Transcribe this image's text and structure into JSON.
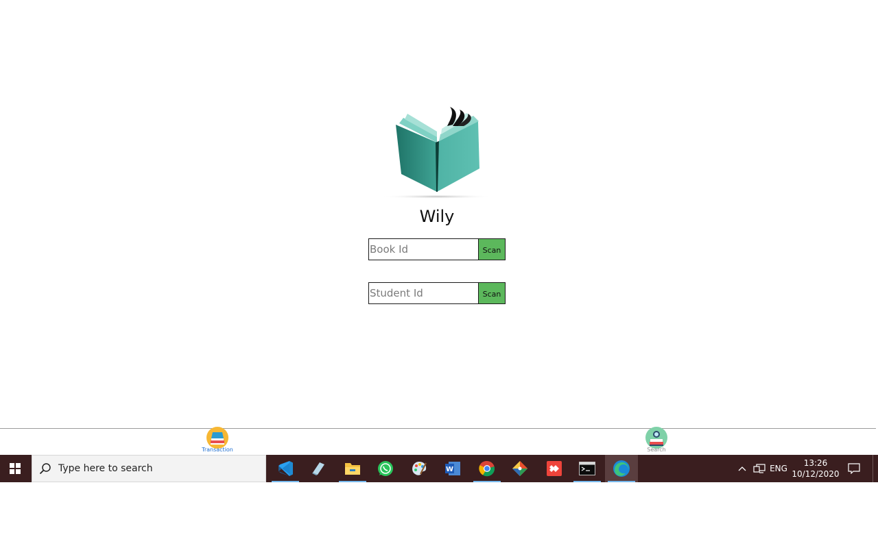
{
  "app": {
    "title": "Wily",
    "book_input": {
      "placeholder": "Book Id",
      "value": ""
    },
    "book_scan_label": "Scan",
    "student_input": {
      "placeholder": "Student Id",
      "value": ""
    },
    "student_scan_label": "Scan"
  },
  "tabs": [
    {
      "label": "Transaction",
      "icon": "book-stack-icon",
      "active": true
    },
    {
      "label": "Search",
      "icon": "search-reader-icon",
      "active": false
    }
  ],
  "taskbar": {
    "search_placeholder": "Type here to search",
    "apps": [
      {
        "name": "vscode-icon",
        "running": true
      },
      {
        "name": "notes-app-icon",
        "running": false
      },
      {
        "name": "file-explorer-icon",
        "running": true
      },
      {
        "name": "whatsapp-icon",
        "running": false
      },
      {
        "name": "paint-icon",
        "running": false
      },
      {
        "name": "word-icon",
        "running": false
      },
      {
        "name": "chrome-icon",
        "running": true
      },
      {
        "name": "git-icon",
        "running": false
      },
      {
        "name": "anydesk-icon",
        "running": false
      },
      {
        "name": "terminal-icon",
        "running": true
      },
      {
        "name": "edge-icon",
        "running": true,
        "active": true
      }
    ],
    "language": "ENG",
    "time": "13:26",
    "date": "10/12/2020"
  },
  "colors": {
    "scan_button": "#5cb85c",
    "taskbar": "#3a1e1f",
    "book_teal_dark": "#237c70",
    "book_teal_light": "#5bbcae",
    "active_tab_label": "#1f6fd1",
    "inactive_tab_label": "#8a8a8a"
  }
}
